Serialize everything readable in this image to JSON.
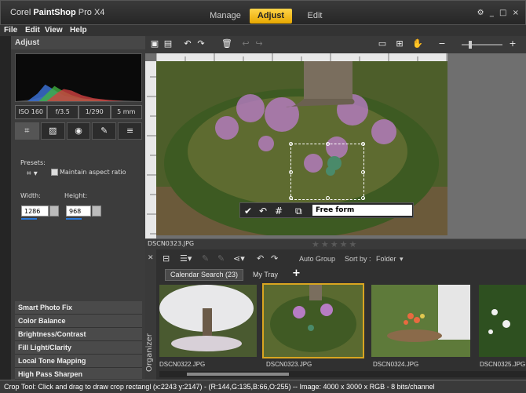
{
  "app": {
    "brand_prefix": "Corel ",
    "brand_name": "PaintShop",
    "brand_suffix": " Pro X4",
    "window_controls": "⚙ _ □ ×"
  },
  "mode_tabs": [
    "Manage",
    "Adjust",
    "Edit"
  ],
  "active_tab": "Adjust",
  "menu": [
    "File",
    "Edit",
    "View",
    "Help"
  ],
  "left_panel": {
    "title": "Adjust",
    "exif": [
      "ISO 160",
      "f/3.5",
      "1/290",
      "5 mm"
    ],
    "tools": [
      "crop-icon",
      "straighten-icon",
      "red-eye-icon",
      "retouch-icon",
      "depth-icon"
    ],
    "presets_label": "Presets:",
    "maintain_aspect_label": "Maintain aspect ratio",
    "width_label": "Width:",
    "height_label": "Height:",
    "width_value": "1286",
    "height_value": "968",
    "categories": [
      "Smart Photo Fix",
      "Color Balance",
      "Brightness/Contrast",
      "Fill Light/Clarity",
      "Local Tone Mapping",
      "High Pass Sharpen"
    ]
  },
  "crop_toolbar": {
    "mode_value": "Free form"
  },
  "file_bar": {
    "filename": "DSCN0323.JPG",
    "stars": "★★★★★"
  },
  "organizer": {
    "label": "Organizer",
    "auto_group": "Auto Group",
    "sort_by": "Sort by :",
    "folder": "Folder",
    "tabs": [
      "Calendar Search (23)",
      "My Tray"
    ],
    "add_tab": "+",
    "thumbnails": [
      {
        "caption": "DSCN0322.JPG"
      },
      {
        "caption": "DSCN0323.JPG"
      },
      {
        "caption": "DSCN0324.JPG"
      },
      {
        "caption": "DSCN0325.JPG"
      }
    ]
  },
  "status": "Crop Tool: Click and drag to draw crop rectangl   (x:2243 y:2147) - (R:144,G:135,B:66,O:255) -- Image:  4000 x 3000 x RGB - 8 bits/channel",
  "colors": {
    "accent": "#e8a800",
    "selection": "#2a78d8"
  }
}
